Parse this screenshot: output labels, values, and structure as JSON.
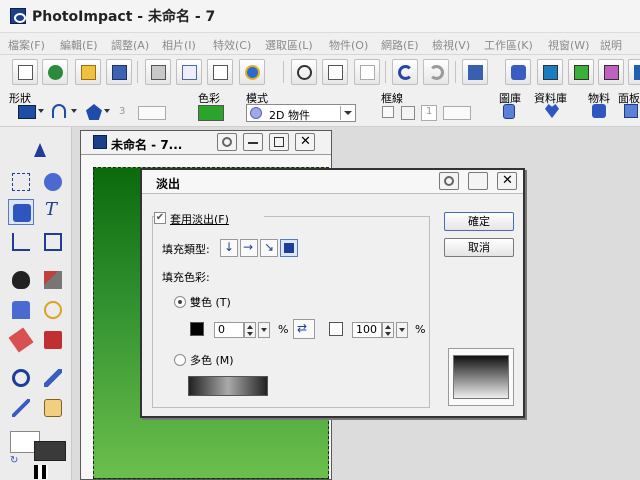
{
  "titlebar": {
    "title": "PhotoImpact - 未命名 - 7"
  },
  "menu": [
    "檔案(F)",
    "編輯(E)",
    "調整(A)",
    "相片(I)",
    "特效(C)",
    "選取區(L)",
    "物件(O)",
    "網路(E)",
    "檢視(V)",
    "工作區(K)",
    "視窗(W)",
    "説明"
  ],
  "attrbar": {
    "shape_label": "形狀",
    "color_label": "色彩",
    "mode_label": "模式",
    "mode_value": "2D 物件",
    "border_label": "框線",
    "border_width": "1",
    "outline_width": "3",
    "icon_labels": [
      "圖庫",
      "資料庫",
      "物料",
      "面板"
    ],
    "fill_color": "#2aa52a"
  },
  "document": {
    "title": "未命名 - 7..."
  },
  "dialog": {
    "title": "淡出",
    "apply_label": "套用淡出(F)",
    "fill_type_label": "填充類型:",
    "fill_color_label": "填充色彩:",
    "two_color_label": "雙色 (T)",
    "multi_color_label": "多色 (M)",
    "from_value": "0",
    "to_value": "100",
    "percent": "%",
    "ok_label": "確定",
    "cancel_label": "取消",
    "from_color": "#000000",
    "to_color": "#ffffff"
  }
}
